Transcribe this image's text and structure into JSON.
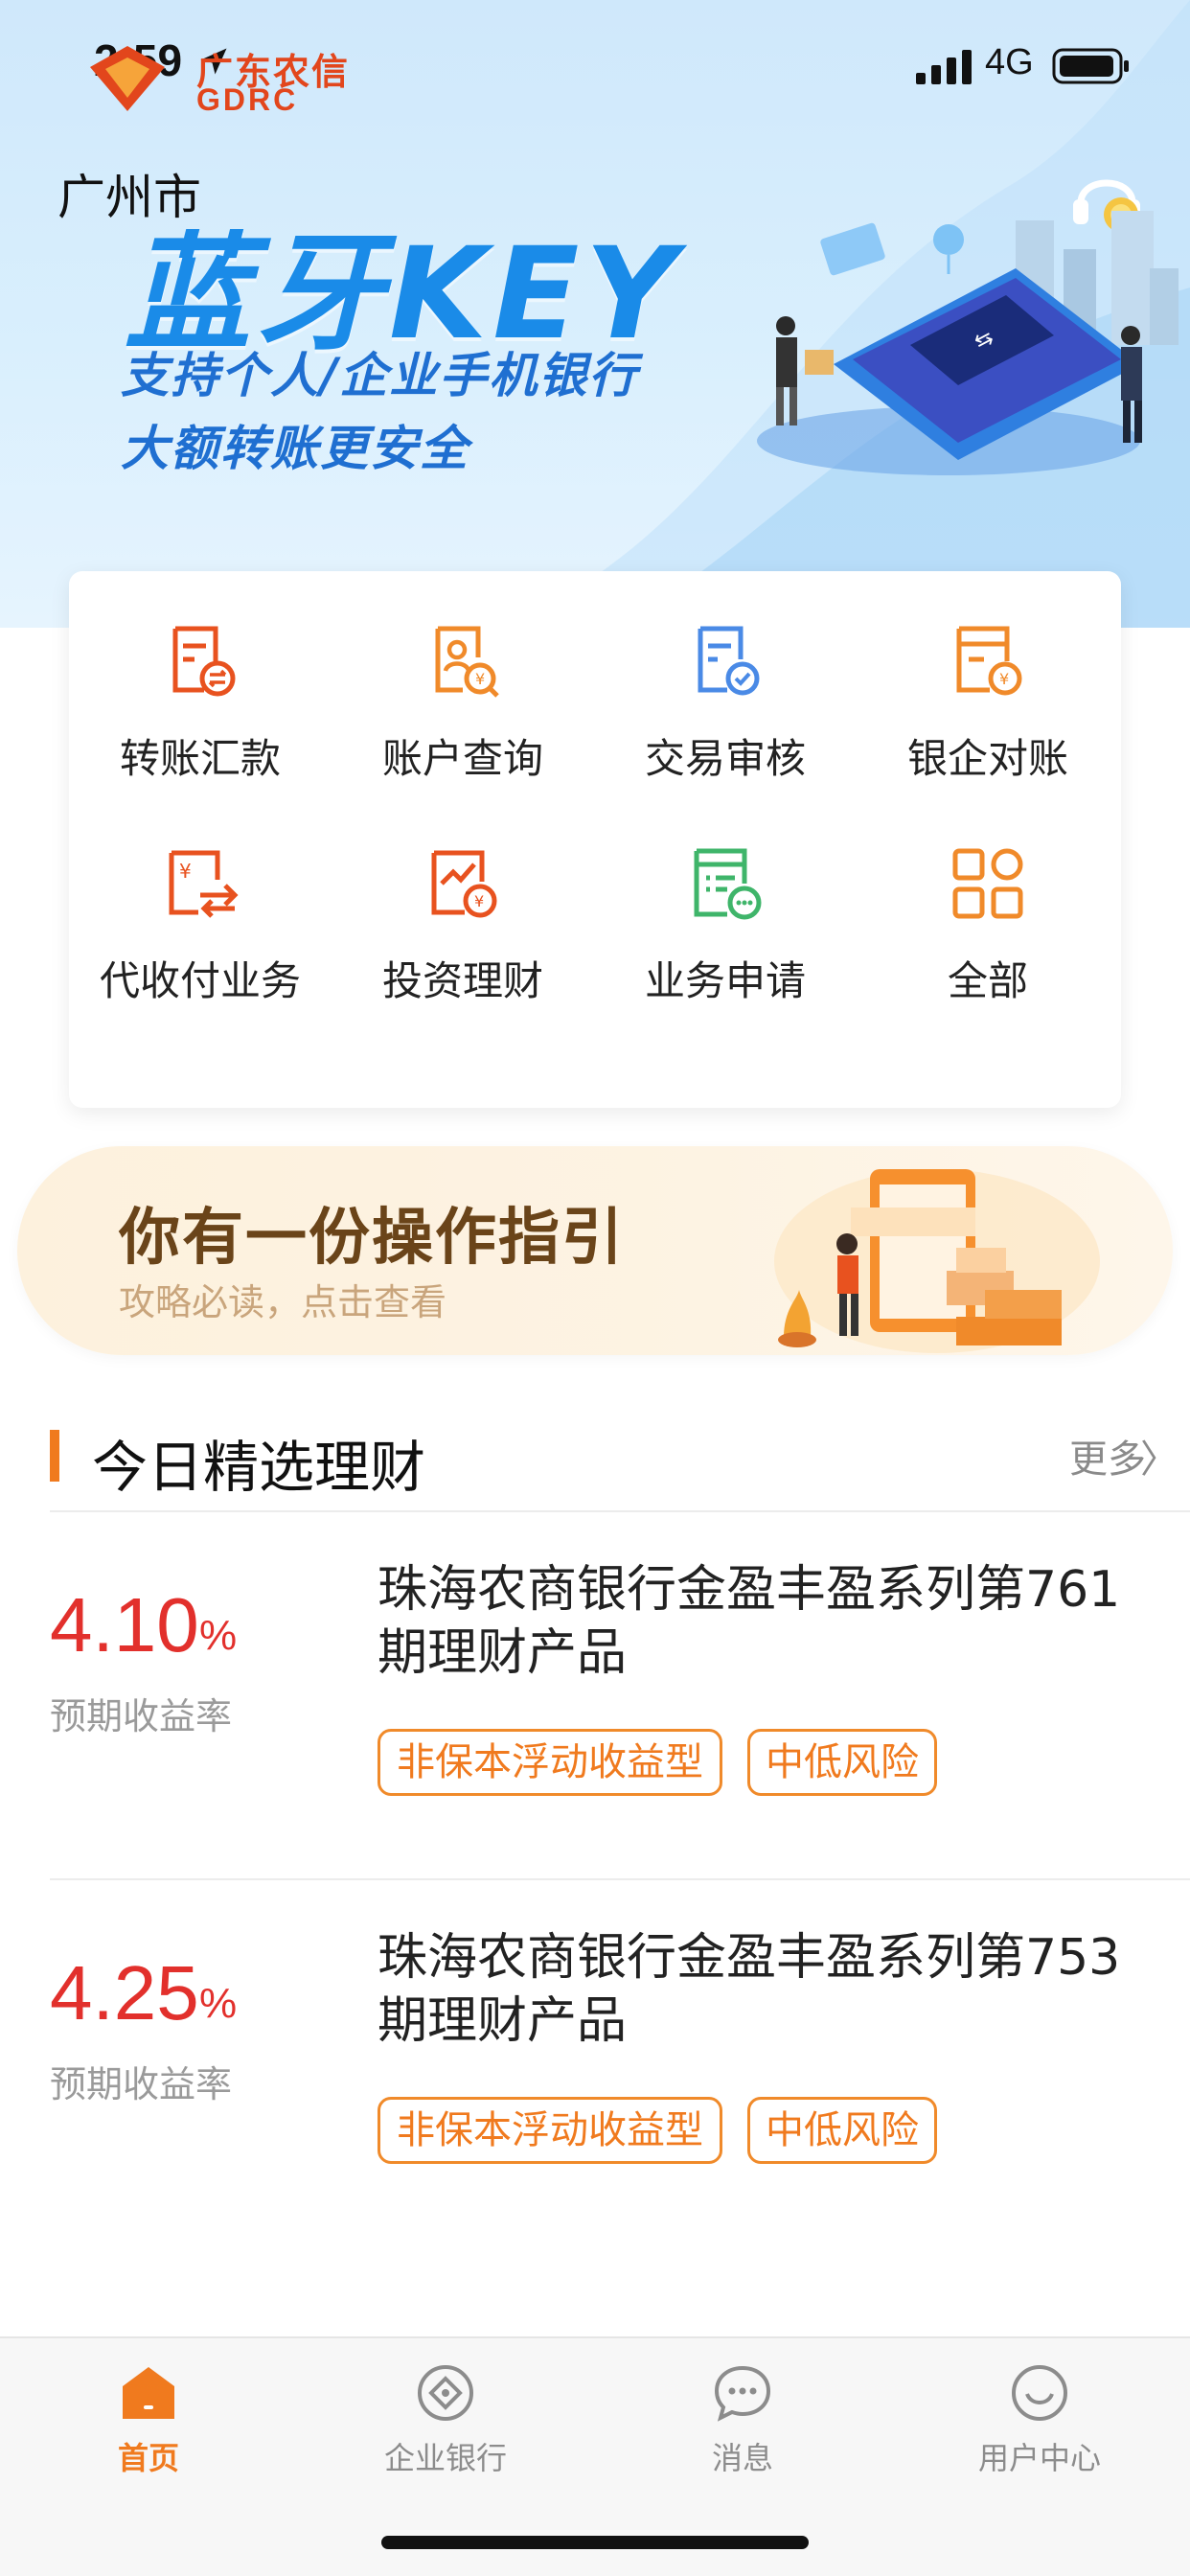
{
  "status_bar": {
    "time": "2:59",
    "network": "4G"
  },
  "header": {
    "brand_name": "广东农信",
    "brand_sub": "GDRC",
    "city": "广州市"
  },
  "banner": {
    "title": "蓝牙KEY",
    "line1": "支持个人/企业手机银行",
    "line2": "大额转账更安全"
  },
  "services": [
    {
      "label": "转账汇款",
      "icon": "transfer-icon"
    },
    {
      "label": "账户查询",
      "icon": "account-query-icon"
    },
    {
      "label": "交易审核",
      "icon": "transaction-review-icon"
    },
    {
      "label": "银企对账",
      "icon": "reconciliation-icon"
    },
    {
      "label": "代收付业务",
      "icon": "collection-payment-icon"
    },
    {
      "label": "投资理财",
      "icon": "investment-icon"
    },
    {
      "label": "业务申请",
      "icon": "business-application-icon"
    },
    {
      "label": "全部",
      "icon": "all-services-icon"
    }
  ],
  "guide": {
    "title": "你有一份操作指引",
    "subtitle": "攻略必读，点击查看"
  },
  "section": {
    "title": "今日精选理财",
    "more": "更多",
    "more_chevron": "〉"
  },
  "products": [
    {
      "rate": "4.10",
      "unit": "%",
      "rate_label": "预期收益率",
      "name": "珠海农商银行金盈丰盈系列第761期理财产品",
      "tags": [
        "非保本浮动收益型",
        "中低风险"
      ]
    },
    {
      "rate": "4.25",
      "unit": "%",
      "rate_label": "预期收益率",
      "name": "珠海农商银行金盈丰盈系列第753期理财产品",
      "tags": [
        "非保本浮动收益型",
        "中低风险"
      ]
    }
  ],
  "tabbar": {
    "items": [
      {
        "label": "首页",
        "icon": "home-icon",
        "active": true
      },
      {
        "label": "企业银行",
        "icon": "enterprise-bank-icon",
        "active": false
      },
      {
        "label": "消息",
        "icon": "message-icon",
        "active": false
      },
      {
        "label": "用户中心",
        "icon": "user-center-icon",
        "active": false
      }
    ]
  },
  "colors": {
    "accent": "#f07a1e",
    "rate_red": "#e2302c",
    "banner_blue": "#1a8be8"
  }
}
